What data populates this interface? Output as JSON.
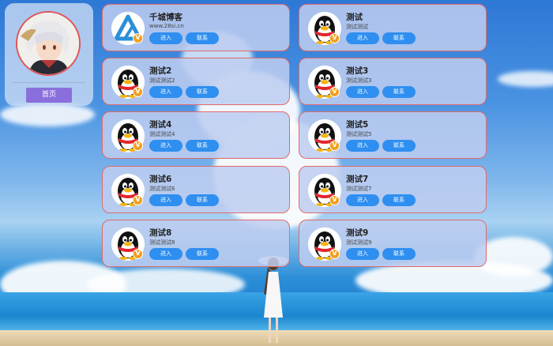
{
  "profile": {
    "home_label": "首页"
  },
  "actions": {
    "enter_label": "进入",
    "contact_label": "联系"
  },
  "badge": "V",
  "cards": [
    {
      "title": "千城博客",
      "desc": "www.28si.cn",
      "logo": "triangle-logo-icon"
    },
    {
      "title": "测试",
      "desc": "测试测试",
      "logo": "penguin-icon"
    },
    {
      "title": "测试2",
      "desc": "测试测试2",
      "logo": "penguin-icon"
    },
    {
      "title": "测试3",
      "desc": "测试测试3",
      "logo": "penguin-icon"
    },
    {
      "title": "测试4",
      "desc": "测试测试4",
      "logo": "penguin-icon"
    },
    {
      "title": "测试5",
      "desc": "测试测试5",
      "logo": "penguin-icon"
    },
    {
      "title": "测试6",
      "desc": "测试测试6",
      "logo": "penguin-icon"
    },
    {
      "title": "测试7",
      "desc": "测试测试7",
      "logo": "penguin-icon"
    },
    {
      "title": "测试8",
      "desc": "测试测试8",
      "logo": "penguin-icon"
    },
    {
      "title": "测试9",
      "desc": "测试测试9",
      "logo": "penguin-icon"
    }
  ],
  "colors": {
    "card_border": "#e06a6a",
    "button": "#2f8ff0",
    "home_button": "#8a6fdc",
    "badge": "#f0a020"
  }
}
